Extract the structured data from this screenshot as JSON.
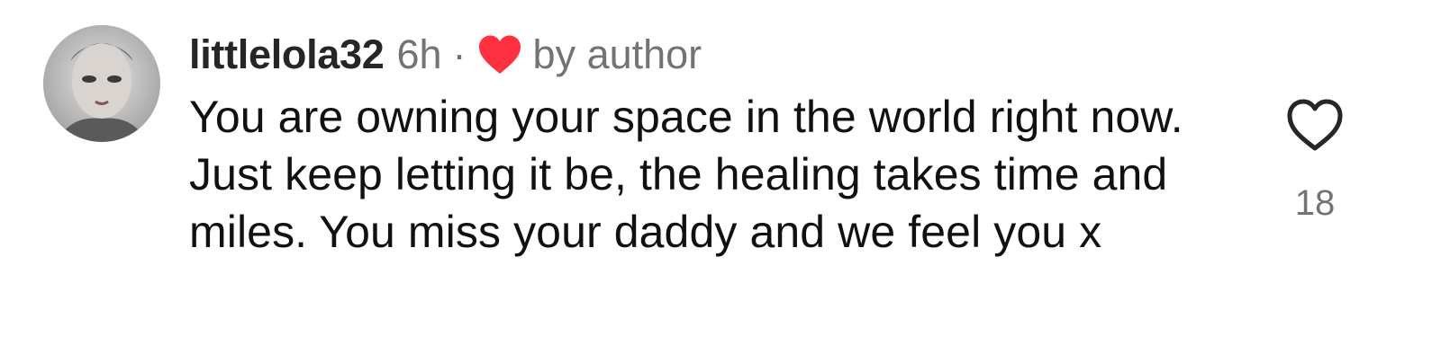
{
  "comment": {
    "username": "littlelola32",
    "time": "6h",
    "separator": "·",
    "liked_by_author_icon": "red-heart-icon",
    "liked_by_author_label": "by author",
    "text": "You are owning your space in the world right now. Just keep letting it be, the healing takes time and miles. You miss your daddy and we feel you x",
    "like_icon": "heart-outline-icon",
    "like_count": "18"
  },
  "colors": {
    "username": "#262626",
    "secondary_text": "#737373",
    "author_heart": "#ff3040",
    "body_text": "#111111"
  }
}
